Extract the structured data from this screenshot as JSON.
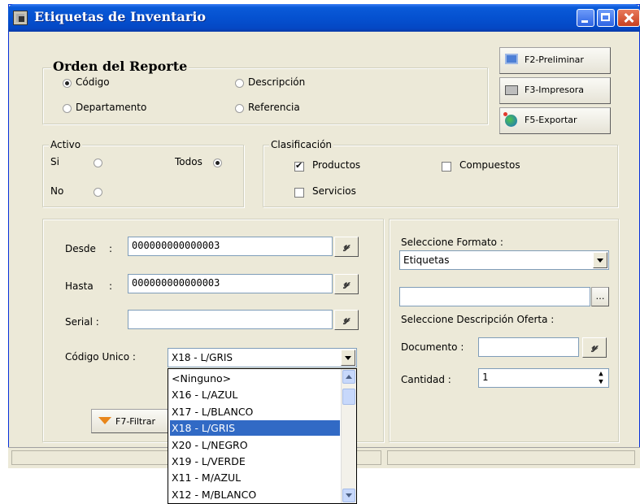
{
  "window": {
    "title": "Etiquetas de Inventario"
  },
  "orden": {
    "legend": "Orden del Reporte",
    "options": [
      {
        "label": "Código",
        "checked": true
      },
      {
        "label": "Descripción",
        "checked": false
      },
      {
        "label": "Departamento",
        "checked": false
      },
      {
        "label": "Referencia",
        "checked": false
      }
    ]
  },
  "actions": {
    "preliminar": "F2-Preliminar",
    "impresora": "F3-Impresora",
    "exportar": "F5-Exportar"
  },
  "activo": {
    "legend": "Activo",
    "si": "Si",
    "no": "No",
    "todos": "Todos",
    "selected": "Todos"
  },
  "clasificacion": {
    "legend": "Clasificación",
    "productos": {
      "label": "Productos",
      "checked": true
    },
    "compuestos": {
      "label": "Compuestos",
      "checked": false
    },
    "servicios": {
      "label": "Servicios",
      "checked": false
    }
  },
  "filtros": {
    "desde_label": "Desde",
    "desde_value": "000000000000003",
    "hasta_label": "Hasta",
    "hasta_value": "000000000000003",
    "serial_label": "Serial :",
    "serial_value": "",
    "codigo_label": "Código Unico :",
    "codigo_value": "X18 - L/GRIS",
    "filtrar_button": "F7-Filtrar",
    "colon": ":"
  },
  "dropdown": {
    "options": [
      "<Ninguno>",
      "X16 - L/AZUL",
      "X17 - L/BLANCO",
      "X18 - L/GRIS",
      "X20 - L/NEGRO",
      "X19 - L/VERDE",
      "X11 - M/AZUL",
      "X12 - M/BLANCO"
    ],
    "selected_index": 3
  },
  "formato": {
    "label": "Seleccione Formato :",
    "value": "Etiquetas",
    "oferta_label": "Seleccione Descripción Oferta :",
    "oferta_value": "",
    "documento_label": "Documento :",
    "documento_value": "",
    "cantidad_label": "Cantidad :",
    "cantidad_value": "1"
  },
  "colors": {
    "titlebar": "#0551d0",
    "face": "#ece9d8",
    "selection": "#316ac5"
  }
}
